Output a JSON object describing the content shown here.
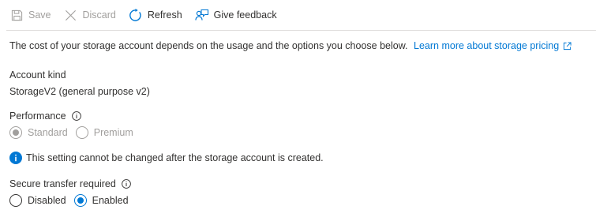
{
  "toolbar": {
    "save_label": "Save",
    "discard_label": "Discard",
    "refresh_label": "Refresh",
    "feedback_label": "Give feedback"
  },
  "intro": {
    "text": "The cost of your storage account depends on the usage and the options you choose below.",
    "link_text": "Learn more about storage pricing"
  },
  "account_kind": {
    "label": "Account kind",
    "value": "StorageV2 (general purpose v2)"
  },
  "performance": {
    "label": "Performance",
    "options": [
      "Standard",
      "Premium"
    ],
    "selected": "Standard",
    "disabled": true
  },
  "notice": {
    "text": "This setting cannot be changed after the storage account is created."
  },
  "secure_transfer": {
    "label": "Secure transfer required",
    "options": [
      "Disabled",
      "Enabled"
    ],
    "selected": "Enabled"
  },
  "colors": {
    "accent": "#0078d4",
    "disabled": "#a19f9d",
    "text": "#323130"
  }
}
